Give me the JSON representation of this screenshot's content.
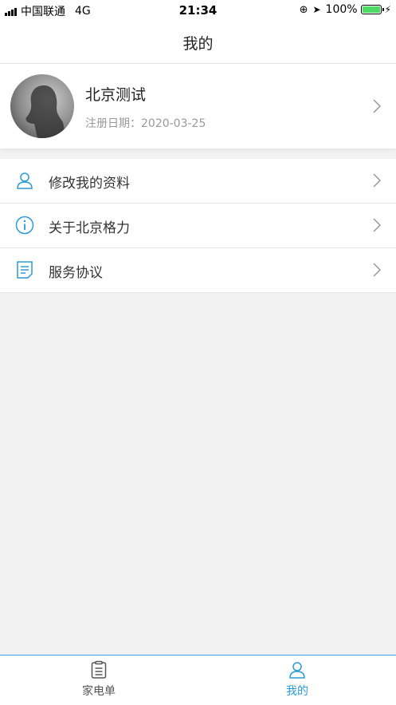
{
  "status_bar": {
    "carrier": "中国联通",
    "network": "4G",
    "time": "21:34",
    "battery": "100%"
  },
  "nav": {
    "title": "我的"
  },
  "profile": {
    "name": "北京测试",
    "register_date": "注册日期：2020-03-25"
  },
  "menu": {
    "items": [
      {
        "label": "修改我的资料",
        "icon": "user-icon"
      },
      {
        "label": "关于北京格力",
        "icon": "info-icon"
      },
      {
        "label": "服务协议",
        "icon": "document-icon"
      }
    ]
  },
  "tab_bar": {
    "tabs": [
      {
        "label": "家电单",
        "icon": "clipboard-icon",
        "active": false
      },
      {
        "label": "我的",
        "icon": "user-icon",
        "active": true
      }
    ]
  },
  "colors": {
    "accent": "#2a9ad6",
    "background": "#f2f2f2",
    "battery": "#4cd964"
  }
}
